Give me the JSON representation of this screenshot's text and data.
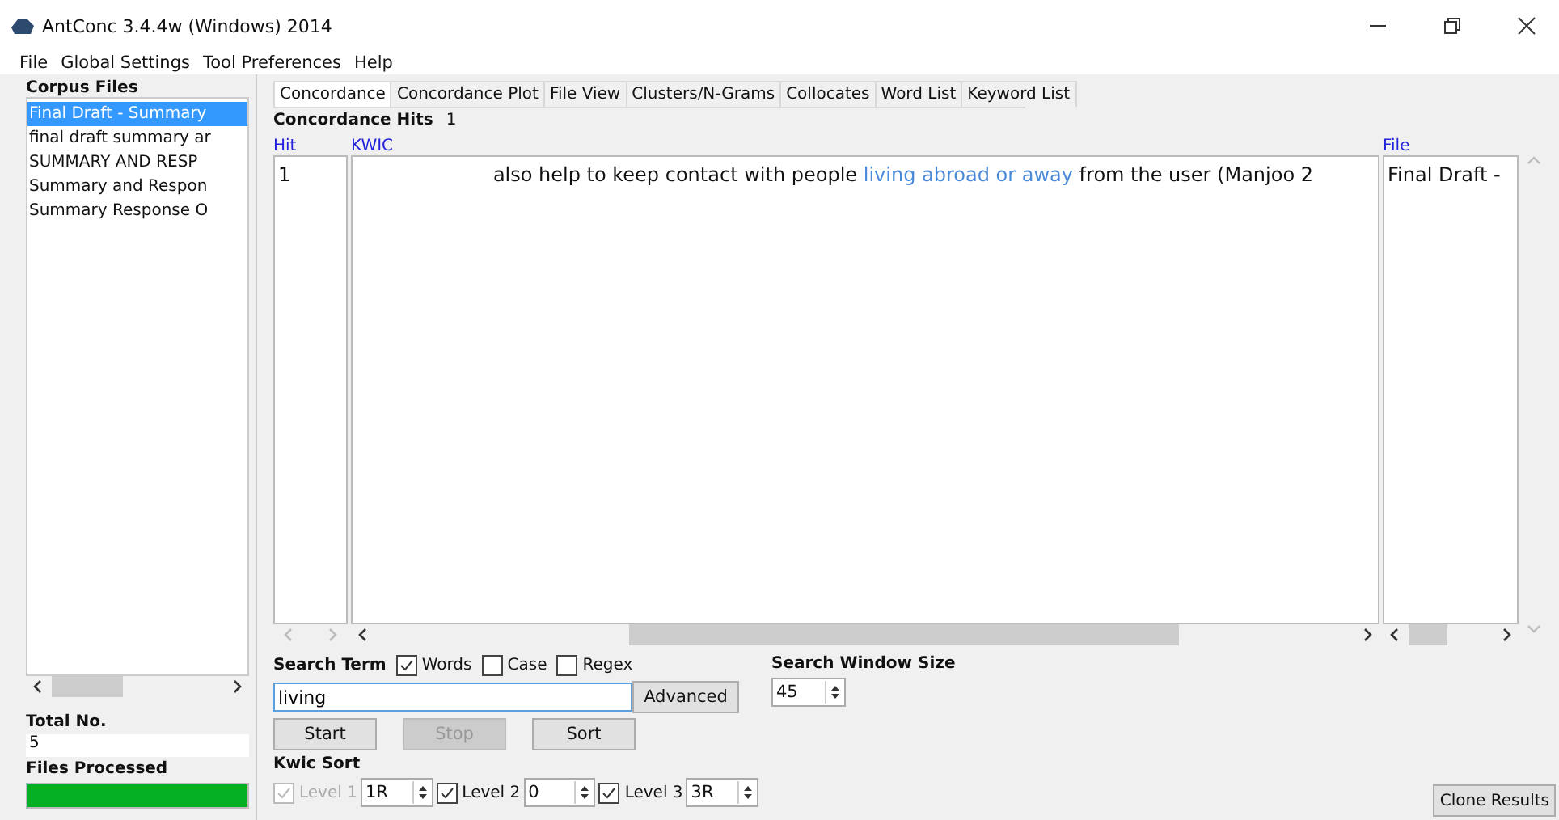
{
  "window": {
    "title": "AntConc 3.4.4w (Windows) 2014"
  },
  "menu": [
    "File",
    "Global Settings",
    "Tool Preferences",
    "Help"
  ],
  "corpus_files": {
    "title": "Corpus Files",
    "items": [
      {
        "label": "Final Draft - Summary",
        "selected": true
      },
      {
        "label": "final draft summary ar",
        "selected": false
      },
      {
        "label": "SUMMARY AND RESP",
        "selected": false
      },
      {
        "label": "Summary and Respon",
        "selected": false
      },
      {
        "label": "Summary Response O",
        "selected": false
      }
    ],
    "total_label": "Total No.",
    "total": "5",
    "processed_label": "Files Processed",
    "progress": {
      "level": 1
    }
  },
  "tabs": [
    {
      "label": "Concordance",
      "selected": true
    },
    {
      "label": "Concordance Plot",
      "selected": false
    },
    {
      "label": "File View",
      "selected": false
    },
    {
      "label": "Clusters/N-Grams",
      "selected": false
    },
    {
      "label": "Collocates",
      "selected": false
    },
    {
      "label": "Word List",
      "selected": false
    },
    {
      "label": "Keyword List",
      "selected": false
    }
  ],
  "hits": {
    "label": "Concordance Hits",
    "count": "1"
  },
  "columns": [
    "Hit",
    "KWIC",
    "File"
  ],
  "rows": [
    {
      "hit": "1",
      "left": "also help to keep contact with people",
      "keyword": "living abroad or away",
      "right": "from the user (Manjoo 2",
      "file": "Final Draft -"
    }
  ],
  "search": {
    "label": "Search Term",
    "options": [
      {
        "label": "Words",
        "checked": true
      },
      {
        "label": "Case",
        "checked": false
      },
      {
        "label": "Regex",
        "checked": false
      }
    ],
    "value": "living",
    "advanced": "Advanced",
    "window_label": "Search Window Size",
    "window_value": "45"
  },
  "buttons": [
    {
      "label": "Start",
      "disabled": false
    },
    {
      "label": "Stop",
      "disabled": true
    },
    {
      "label": "Sort",
      "disabled": false
    }
  ],
  "kwic_sort": {
    "label": "Kwic Sort",
    "levels": [
      {
        "label": "Level 1",
        "checked": true,
        "disabled": true,
        "value": "1R"
      },
      {
        "label": "Level 2",
        "checked": true,
        "disabled": false,
        "value": "0"
      },
      {
        "label": "Level 3",
        "checked": true,
        "disabled": false,
        "value": "3R"
      }
    ]
  },
  "clone": "Clone Results"
}
